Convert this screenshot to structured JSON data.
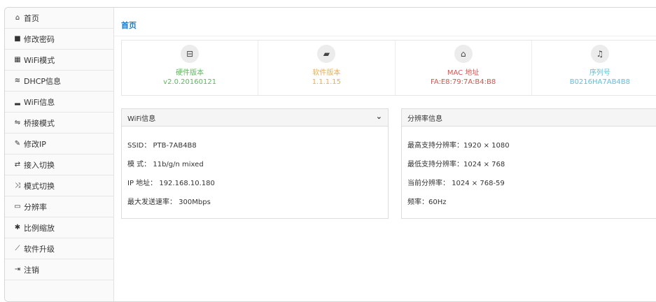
{
  "sidebar": {
    "items": [
      {
        "icon": "home-icon",
        "glyph": "⌂",
        "label": "首页"
      },
      {
        "icon": "lock-icon",
        "glyph": "🔒",
        "label": "修改密码"
      },
      {
        "icon": "grid-icon",
        "glyph": "▦",
        "label": "WiFi模式"
      },
      {
        "icon": "wifi-icon",
        "glyph": "≋",
        "label": "DHCP信息"
      },
      {
        "icon": "signal-icon",
        "glyph": "▂",
        "label": "WiFi信息"
      },
      {
        "icon": "bridge-icon",
        "glyph": "⇋",
        "label": "桥接模式"
      },
      {
        "icon": "edit-icon",
        "glyph": "✎",
        "label": "修改IP"
      },
      {
        "icon": "exchange-icon",
        "glyph": "⇄",
        "label": "接入切换"
      },
      {
        "icon": "shuffle-icon",
        "glyph": "⤨",
        "label": "模式切换"
      },
      {
        "icon": "monitor-icon",
        "glyph": "▭",
        "label": "分辨率"
      },
      {
        "icon": "asterisk-icon",
        "glyph": "✱",
        "label": "比例缩放"
      },
      {
        "icon": "chart-icon",
        "glyph": "⟋",
        "label": "软件升级"
      },
      {
        "icon": "logout-icon",
        "glyph": "⇥",
        "label": "注销"
      }
    ]
  },
  "main": {
    "title": "首页",
    "stats": [
      {
        "icon": "hdd-icon",
        "glyph": "⊟",
        "label": "硬件版本",
        "value": "v2.0.20160121",
        "color": "#5cb85c"
      },
      {
        "icon": "book-icon",
        "glyph": "▰",
        "label": "软件版本",
        "value": "1.1.1.15",
        "color": "#f0ad4e"
      },
      {
        "icon": "bank-icon",
        "glyph": "⌂",
        "label": "MAC 地址",
        "value": "FA:E8:79:7A:B4:B8",
        "color": "#d9534f"
      },
      {
        "icon": "bell-icon",
        "glyph": "♫",
        "label": "序列号",
        "value": "B0216HA7AB4B8",
        "color": "#5bc0de"
      }
    ],
    "wifi_panel": {
      "title": "WiFi信息",
      "rows": [
        "SSID： PTB-7AB4B8",
        "模 式： 11b/g/n mixed",
        "IP 地址： 192.168.10.180",
        "最大发送速率： 300Mbps"
      ]
    },
    "res_panel": {
      "title": "分辨率信息",
      "rows": [
        "最高支持分辨率：1920 × 1080",
        "最低支持分辨率：1024 × 768",
        "当前分辨率： 1024 × 768-59",
        "频率：60Hz"
      ]
    }
  }
}
